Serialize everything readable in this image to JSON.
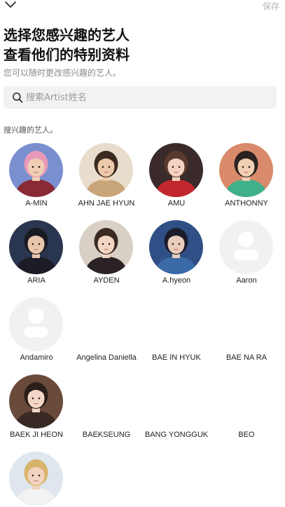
{
  "header": {
    "save_label": "保存",
    "back_icon": "chevron-down-icon"
  },
  "title_line1": "选择您感兴趣的艺人",
  "title_line2": "查看他们的特别资料",
  "subtitle": "您可以随时更改感兴趣的艺人。",
  "search": {
    "placeholder": "搜索Artist姓名",
    "value": "",
    "icon": "search-icon"
  },
  "section_label": "搜兴趣的艺人。",
  "artists": [
    {
      "name": "A-MIN",
      "avatar": "photo",
      "bg": "#7a8fcf",
      "skin": "#f0cdb5",
      "hair": "#e79ab8",
      "shirt": "#8a2a35"
    },
    {
      "name": "AHN JAE HYUN",
      "avatar": "photo",
      "bg": "#e8ddcc",
      "skin": "#eccaa9",
      "hair": "#3b2a20",
      "shirt": "#c9a57a"
    },
    {
      "name": "AMU",
      "avatar": "photo",
      "bg": "#3a2a2a",
      "skin": "#f3d3c0",
      "hair": "#5a3a2e",
      "shirt": "#c0262b"
    },
    {
      "name": "ANTHONNY",
      "avatar": "photo",
      "bg": "#d98a6a",
      "skin": "#f1cfb3",
      "hair": "#2a221e",
      "shirt": "#3fb08a"
    },
    {
      "name": "ARIA",
      "avatar": "photo",
      "bg": "#2a3550",
      "skin": "#e8c7ad",
      "hair": "#1a1a22",
      "shirt": "#1c1c26"
    },
    {
      "name": "AYDEN",
      "avatar": "photo",
      "bg": "#d9d0c5",
      "skin": "#f2d6c3",
      "hair": "#3a2a22",
      "shirt": "#2a2226"
    },
    {
      "name": "A.hyeon",
      "avatar": "photo",
      "bg": "#2f4f86",
      "skin": "#e9cdbc",
      "hair": "#1c1c2a",
      "shirt": "#3a6aa8"
    },
    {
      "name": "Aaron",
      "avatar": "placeholder"
    },
    {
      "name": "Andamiro",
      "avatar": "placeholder"
    },
    {
      "name": "Angelina Daniella",
      "avatar": "none"
    },
    {
      "name": "BAE IN HYUK",
      "avatar": "none"
    },
    {
      "name": "BAE NA RA",
      "avatar": "none"
    },
    {
      "name": "BAEK JI HEON",
      "avatar": "photo",
      "bg": "#6a4a3a",
      "skin": "#f3d6c6",
      "hair": "#2a1e1a",
      "shirt": "#3a2a26"
    },
    {
      "name": "BAEKSEUNG",
      "avatar": "none"
    },
    {
      "name": "BANG YONGGUK",
      "avatar": "none"
    },
    {
      "name": "BEO",
      "avatar": "none"
    },
    {
      "name": "",
      "avatar": "photo",
      "bg": "#dfe6ee",
      "skin": "#f2d3bf",
      "hair": "#d8b46a",
      "shirt": "#f2f2f2"
    }
  ]
}
